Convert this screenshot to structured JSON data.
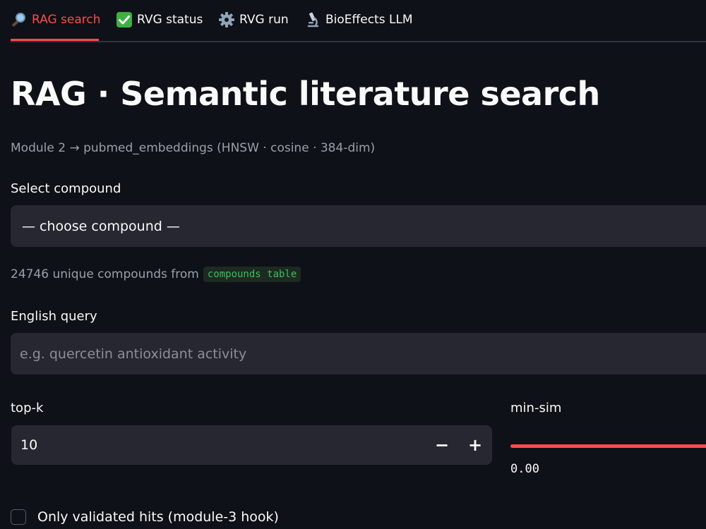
{
  "tabs": [
    {
      "label": "RAG search",
      "icon": "magnifier-icon",
      "active": true
    },
    {
      "label": "RVG status",
      "icon": "check-mark-icon",
      "active": false
    },
    {
      "label": "RVG run",
      "icon": "gear-icon",
      "active": false
    },
    {
      "label": "BioEffects LLM",
      "icon": "microscope-icon",
      "active": false
    }
  ],
  "page": {
    "title": "RAG · Semantic literature search",
    "caption": "Module 2 → pubmed_embeddings (HNSW · cosine · 384-dim)"
  },
  "compound_select": {
    "label": "Select compound",
    "selected": "— choose compound —",
    "helper_text": "24746 unique compounds from",
    "helper_code": "compounds table"
  },
  "query": {
    "label": "English query",
    "value": "",
    "placeholder": "e.g. quercetin antioxidant activity"
  },
  "top_k": {
    "label": "top-k",
    "value": "10",
    "decrement_label": "−",
    "increment_label": "+"
  },
  "min_sim": {
    "label": "min-sim",
    "value": "0.00"
  },
  "validated_only": {
    "label": "Only validated hits (module-3 hook)",
    "checked": false
  },
  "colors": {
    "accent": "#ff4b4b",
    "background": "#0e1117",
    "input_background": "#262730",
    "code_green": "#3fbf5e"
  }
}
